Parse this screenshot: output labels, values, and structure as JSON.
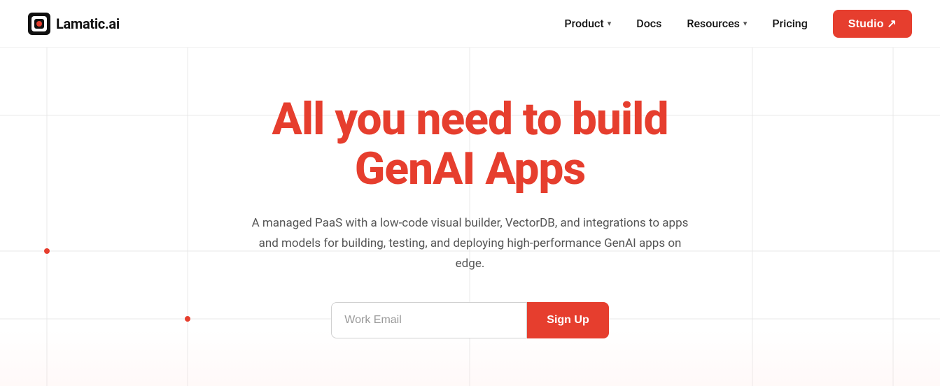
{
  "brand": {
    "name": "Lamatic.ai"
  },
  "nav": {
    "product_label": "Product",
    "docs_label": "Docs",
    "resources_label": "Resources",
    "pricing_label": "Pricing",
    "studio_label": "Studio ↗"
  },
  "hero": {
    "title_line1": "All you need to build",
    "title_line2": "GenAI Apps",
    "subtitle": "A managed PaaS with a low-code visual builder, VectorDB, and integrations to apps and models for building, testing, and deploying high-performance GenAI apps on edge.",
    "email_placeholder": "Work Email",
    "signup_label": "Sign Up"
  },
  "colors": {
    "accent": "#e63e2e",
    "text_primary": "#111111",
    "text_muted": "#555555"
  }
}
